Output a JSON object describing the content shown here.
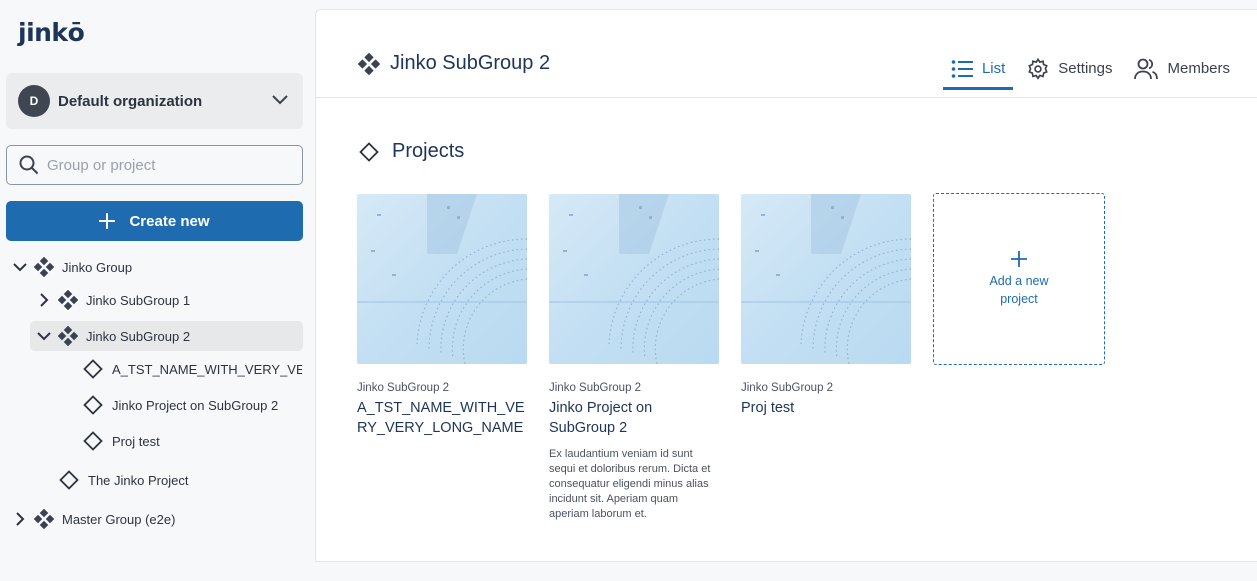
{
  "app": {
    "logo": "jinkō"
  },
  "org": {
    "initial": "D",
    "name": "Default organization"
  },
  "search": {
    "placeholder": "Group or project"
  },
  "create": {
    "label": "Create new"
  },
  "tree": {
    "jinko_group": "Jinko Group",
    "subgroup1": "Jinko SubGroup 1",
    "subgroup2": "Jinko SubGroup 2",
    "proj_long": "A_TST_NAME_WITH_VERY_VERY_",
    "proj_on_sub2": "Jinko Project on SubGroup 2",
    "proj_test": "Proj test",
    "the_jinko_project": "The Jinko Project",
    "master_group": "Master Group (e2e)"
  },
  "header": {
    "title": "Jinko SubGroup 2",
    "tabs": [
      {
        "label": "List",
        "icon": "list-icon",
        "active": true
      },
      {
        "label": "Settings",
        "icon": "gear-icon",
        "active": false
      },
      {
        "label": "Members",
        "icon": "members-icon",
        "active": false
      }
    ]
  },
  "section": {
    "title": "Projects"
  },
  "projects": [
    {
      "group": "Jinko SubGroup 2",
      "name": "A_TST_NAME_WITH_VERY_VERY_LONG_NAME",
      "description": ""
    },
    {
      "group": "Jinko SubGroup 2",
      "name": "Jinko Project on SubGroup 2",
      "description": "Ex laudantium veniam id sunt sequi et doloribus rerum. Dicta et consequatur eligendi minus alias incidunt sit. Aperiam quam aperiam laborum et."
    },
    {
      "group": "Jinko SubGroup 2",
      "name": "Proj test",
      "description": ""
    }
  ],
  "add_project": {
    "label": "Add a new project"
  },
  "colors": {
    "primary": "#1f6bb0",
    "title": "#1d3557"
  }
}
